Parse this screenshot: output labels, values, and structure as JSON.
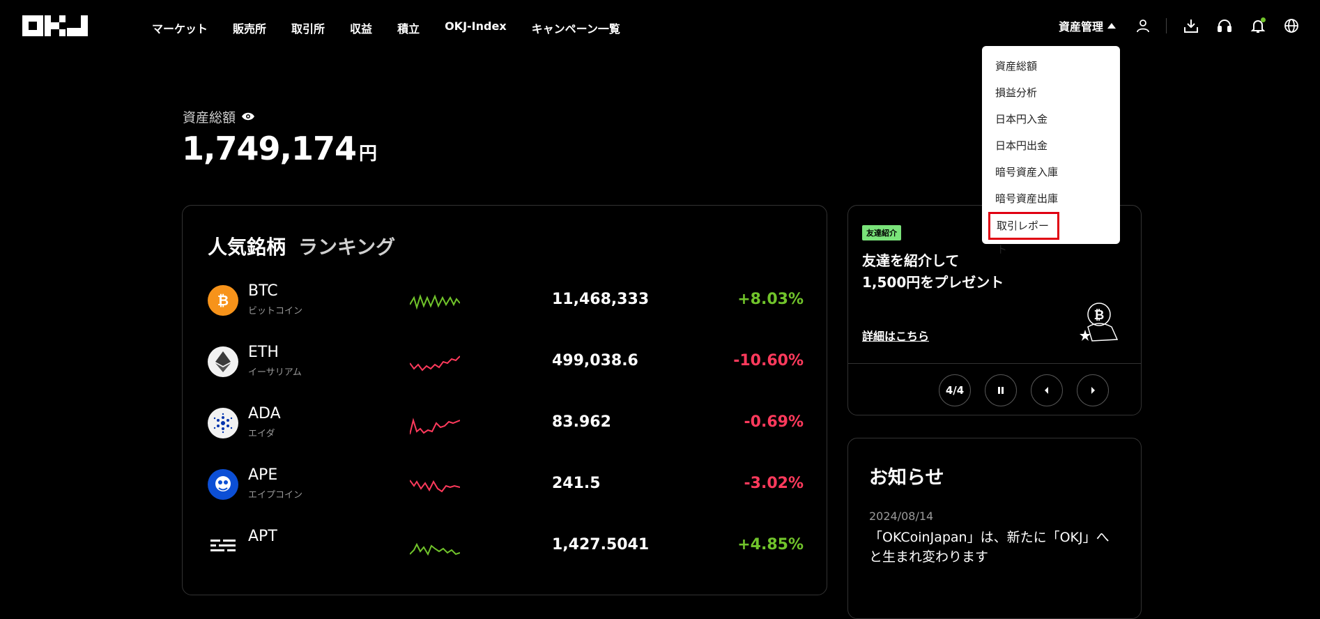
{
  "nav": {
    "items": [
      "マーケット",
      "販売所",
      "取引所",
      "収益",
      "積立",
      "OKJ-Index",
      "キャンペーン一覧"
    ]
  },
  "header": {
    "asset_management": "資産管理",
    "icons": [
      "user-icon",
      "download-icon",
      "headset-icon",
      "bell-icon",
      "globe-icon"
    ]
  },
  "dropdown": {
    "items": [
      "資産総額",
      "損益分析",
      "日本円入金",
      "日本円出金",
      "暗号資産入庫",
      "暗号資産出庫",
      "取引レポート"
    ],
    "highlighted": "取引レポート"
  },
  "total": {
    "label": "資産総額",
    "value": "1,749,174",
    "unit": "円"
  },
  "ranking": {
    "title": "人気銘柄",
    "subtitle": "ランキング",
    "coins": [
      {
        "symbol": "BTC",
        "name": "ビットコイン",
        "price": "11,468,333",
        "change": "+8.03%",
        "trend": "up"
      },
      {
        "symbol": "ETH",
        "name": "イーサリアム",
        "price": "499,038.6",
        "change": "-10.60%",
        "trend": "down"
      },
      {
        "symbol": "ADA",
        "name": "エイダ",
        "price": "83.962",
        "change": "-0.69%",
        "trend": "down"
      },
      {
        "symbol": "APE",
        "name": "エイプコイン",
        "price": "241.5",
        "change": "-3.02%",
        "trend": "down"
      },
      {
        "symbol": "APT",
        "name": "",
        "price": "1,427.5041",
        "change": "+4.85%",
        "trend": "up"
      }
    ]
  },
  "promo": {
    "tag": "友達紹介",
    "line1": "友達を紹介して",
    "line2": "1,500円をプレゼント",
    "link": "詳細はこちら",
    "counter": "4/4"
  },
  "news": {
    "title": "お知らせ",
    "date": "2024/08/14",
    "text": "「OKCoinJapan」は、新たに「OKJ」へと生まれ変わります"
  },
  "colors": {
    "up": "#71c42b",
    "down": "#ff3a5c",
    "highlight_border": "#e00012",
    "promo_tag": "#7ae37a"
  }
}
